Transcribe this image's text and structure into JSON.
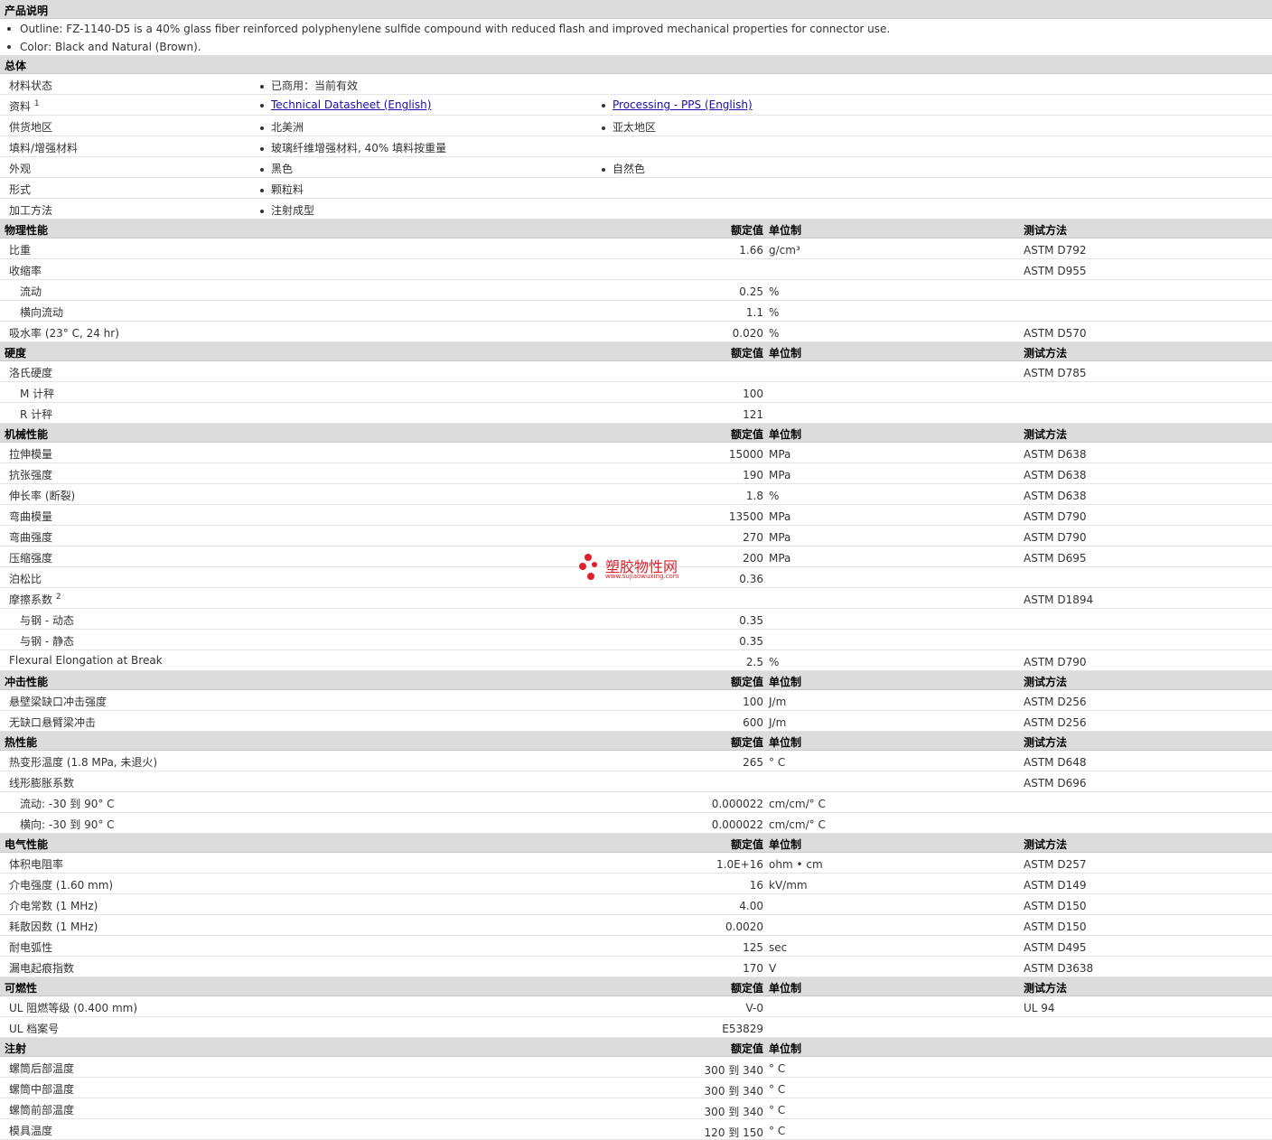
{
  "desc": {
    "title": "产品说明",
    "items": [
      "Outline: FZ-1140-D5 is a 40% glass fiber reinforced polyphenylene sulfide compound with reduced flash and improved mechanical properties for connector use.",
      "Color: Black and Natural (Brown)."
    ]
  },
  "general": {
    "title": "总体",
    "rows": [
      {
        "label": "材料状态",
        "c1": "已商用：当前有效",
        "c2": ""
      },
      {
        "label": "资料",
        "sup": "1",
        "c1": "Technical Datasheet (English)",
        "c2": "Processing - PPS (English)",
        "link": true
      },
      {
        "label": "供货地区",
        "c1": "北美洲",
        "c2": "亚太地区"
      },
      {
        "label": "填料/增强材料",
        "c1": "玻璃纤维增强材料, 40% 填料按重量",
        "c2": ""
      },
      {
        "label": "外观",
        "c1": "黑色",
        "c2": "自然色"
      },
      {
        "label": "形式",
        "c1": "颗粒料",
        "c2": ""
      },
      {
        "label": "加工方法",
        "c1": "注射成型",
        "c2": ""
      }
    ]
  },
  "cols": {
    "value": "额定值",
    "unit": "单位制",
    "method": "测试方法"
  },
  "sections": [
    {
      "title": "物理性能",
      "method_col": true,
      "rows": [
        {
          "label": "比重",
          "value": "1.66",
          "unit": "g/cm³",
          "method": "ASTM D792"
        },
        {
          "label": "收缩率",
          "value": "",
          "unit": "",
          "method": "ASTM D955"
        },
        {
          "label": "流动",
          "indent": true,
          "value": "0.25",
          "unit": "%",
          "method": ""
        },
        {
          "label": "横向流动",
          "indent": true,
          "value": "1.1",
          "unit": "%",
          "method": ""
        },
        {
          "label": "吸水率 (23° C, 24 hr)",
          "value": "0.020",
          "unit": "%",
          "method": "ASTM D570"
        }
      ]
    },
    {
      "title": "硬度",
      "method_col": true,
      "rows": [
        {
          "label": "洛氏硬度",
          "value": "",
          "unit": "",
          "method": "ASTM D785"
        },
        {
          "label": "M 计秤",
          "indent": true,
          "value": "100",
          "unit": "",
          "method": ""
        },
        {
          "label": "R 计秤",
          "indent": true,
          "value": "121",
          "unit": "",
          "method": ""
        }
      ]
    },
    {
      "title": "机械性能",
      "method_col": true,
      "rows": [
        {
          "label": "拉伸模量",
          "value": "15000",
          "unit": "MPa",
          "method": "ASTM D638"
        },
        {
          "label": "抗张强度",
          "value": "190",
          "unit": "MPa",
          "method": "ASTM D638"
        },
        {
          "label": "伸长率 (断裂)",
          "value": "1.8",
          "unit": "%",
          "method": "ASTM D638"
        },
        {
          "label": "弯曲模量",
          "value": "13500",
          "unit": "MPa",
          "method": "ASTM D790"
        },
        {
          "label": "弯曲强度",
          "value": "270",
          "unit": "MPa",
          "method": "ASTM D790"
        },
        {
          "label": "压缩强度",
          "value": "200",
          "unit": "MPa",
          "method": "ASTM D695"
        },
        {
          "label": "泊松比",
          "value": "0.36",
          "unit": "",
          "method": ""
        },
        {
          "label": "摩擦系数",
          "sup": "2",
          "value": "",
          "unit": "",
          "method": "ASTM D1894"
        },
        {
          "label": "与钢 - 动态",
          "indent": true,
          "value": "0.35",
          "unit": "",
          "method": ""
        },
        {
          "label": "与钢 - 静态",
          "indent": true,
          "value": "0.35",
          "unit": "",
          "method": ""
        },
        {
          "label": "Flexural Elongation at Break",
          "value": "2.5",
          "unit": "%",
          "method": "ASTM D790"
        }
      ]
    },
    {
      "title": "冲击性能",
      "method_col": true,
      "rows": [
        {
          "label": "悬壁梁缺口冲击强度",
          "value": "100",
          "unit": "J/m",
          "method": "ASTM D256"
        },
        {
          "label": "无缺口悬臂梁冲击",
          "value": "600",
          "unit": "J/m",
          "method": "ASTM D256"
        }
      ]
    },
    {
      "title": "热性能",
      "method_col": true,
      "rows": [
        {
          "label": "热变形温度 (1.8 MPa, 未退火)",
          "value": "265",
          "unit": "° C",
          "method": "ASTM D648"
        },
        {
          "label": "线形膨胀系数",
          "value": "",
          "unit": "",
          "method": "ASTM D696"
        },
        {
          "label": "流动: -30 到 90° C",
          "indent": true,
          "value": "0.000022",
          "unit": "cm/cm/° C",
          "method": ""
        },
        {
          "label": "横向: -30 到 90° C",
          "indent": true,
          "value": "0.000022",
          "unit": "cm/cm/° C",
          "method": ""
        }
      ]
    },
    {
      "title": "电气性能",
      "method_col": true,
      "rows": [
        {
          "label": "体积电阻率",
          "value": "1.0E+16",
          "unit": "ohm • cm",
          "method": "ASTM D257"
        },
        {
          "label": "介电强度 (1.60 mm)",
          "value": "16",
          "unit": "kV/mm",
          "method": "ASTM D149"
        },
        {
          "label": "介电常数 (1 MHz)",
          "value": "4.00",
          "unit": "",
          "method": "ASTM D150"
        },
        {
          "label": "耗散因数 (1 MHz)",
          "value": "0.0020",
          "unit": "",
          "method": "ASTM D150"
        },
        {
          "label": "耐电弧性",
          "value": "125",
          "unit": "sec",
          "method": "ASTM D495"
        },
        {
          "label": "漏电起痕指数",
          "value": "170",
          "unit": "V",
          "method": "ASTM D3638"
        }
      ]
    },
    {
      "title": "可燃性",
      "method_col": true,
      "rows": [
        {
          "label": "UL 阻燃等级 (0.400 mm)",
          "value": "V-0",
          "unit": "",
          "method": "UL 94"
        },
        {
          "label": "UL 档案号",
          "value": "E53829",
          "unit": "",
          "method": ""
        }
      ]
    },
    {
      "title": "注射",
      "method_col": false,
      "rows": [
        {
          "label": "螺筒后部温度",
          "value": "300 到 340",
          "unit": "° C",
          "method": ""
        },
        {
          "label": "螺筒中部温度",
          "value": "300 到 340",
          "unit": "° C",
          "method": ""
        },
        {
          "label": "螺筒前部温度",
          "value": "300 到 340",
          "unit": "° C",
          "method": ""
        },
        {
          "label": "模具温度",
          "value": "120 到 150",
          "unit": "° C",
          "method": ""
        }
      ]
    }
  ],
  "watermark": {
    "text": "塑胶物性网",
    "url": "www.sujiaowuxing.com"
  }
}
